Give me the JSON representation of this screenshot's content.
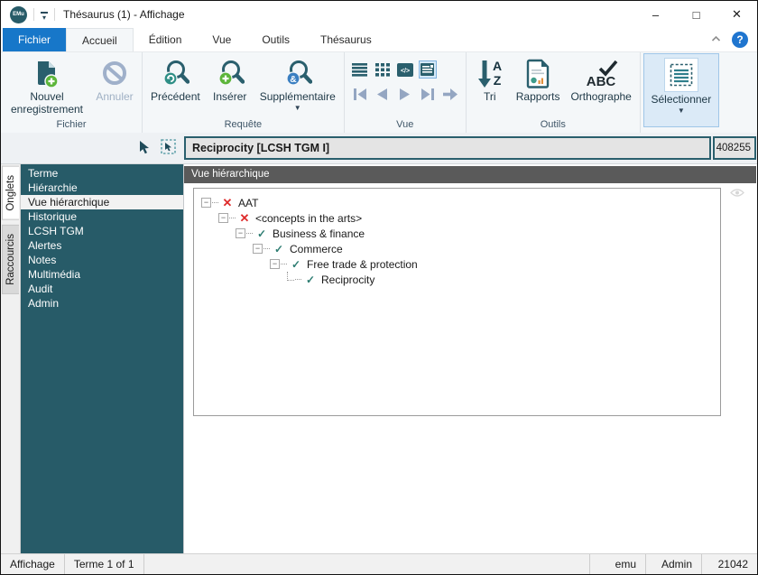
{
  "titlebar": {
    "logo_text": "EMu",
    "title": "Thésaurus (1) - Affichage",
    "minimize": "–",
    "maximize": "□",
    "close": "✕"
  },
  "help_label": "?",
  "menu_tabs": {
    "fichier": "Fichier",
    "accueil": "Accueil",
    "edition": "Édition",
    "vue": "Vue",
    "outils": "Outils",
    "thesaurus": "Thésaurus"
  },
  "ribbon": {
    "group_labels": {
      "fichier": "Fichier",
      "requete": "Requête",
      "vue": "Vue",
      "outils": "Outils"
    },
    "buttons": {
      "new_record": "Nouvel enregistrement",
      "undo": "Annuler",
      "previous": "Précédent",
      "insert": "Insérer",
      "additional": "Supplémentaire",
      "sort": "Tri",
      "reports": "Rapports",
      "spelling": "Orthographe",
      "select": "Sélectionner"
    }
  },
  "record_bar": {
    "summary": "Reciprocity [LCSH TGM I]",
    "irn": "408255"
  },
  "side_tabs": {
    "onglets": "Onglets",
    "raccourcis": "Raccourcis"
  },
  "sidebar": {
    "items": [
      {
        "label": "Terme"
      },
      {
        "label": "Hiérarchie"
      },
      {
        "label": "Vue hiérarchique",
        "selected": true
      },
      {
        "label": "Historique"
      },
      {
        "label": "LCSH TGM"
      },
      {
        "label": "Alertes"
      },
      {
        "label": "Notes"
      },
      {
        "label": "Multimédia"
      },
      {
        "label": "Audit"
      },
      {
        "label": "Admin"
      }
    ]
  },
  "panel": {
    "header": "Vue hiérarchique"
  },
  "tree": {
    "collapse_glyph": "−",
    "x_glyph": "✕",
    "check_glyph": "✓",
    "items": [
      {
        "label": "AAT",
        "level": 0,
        "mark": "x"
      },
      {
        "label": "<concepts in the arts>",
        "level": 1,
        "mark": "x"
      },
      {
        "label": "Business & finance",
        "level": 2,
        "mark": "check"
      },
      {
        "label": "Commerce",
        "level": 3,
        "mark": "check"
      },
      {
        "label": "Free trade & protection",
        "level": 4,
        "mark": "check"
      },
      {
        "label": "Reciprocity",
        "level": 5,
        "mark": "check",
        "last": true
      }
    ]
  },
  "statusbar": {
    "left": [
      "Affichage",
      "Terme 1 of 1"
    ],
    "right": [
      "emu",
      "Admin",
      "21042"
    ]
  },
  "colors": {
    "sidebar_teal": "#275b68",
    "icon_teal": "#2a5f6d",
    "tab_blue": "#1777c9",
    "mark_red": "#de2b2b",
    "mark_check": "#2e7d72",
    "header_gray": "#5a5a5a",
    "plus_green": "#5cb53a",
    "badge_blue": "#3a7fc1"
  }
}
